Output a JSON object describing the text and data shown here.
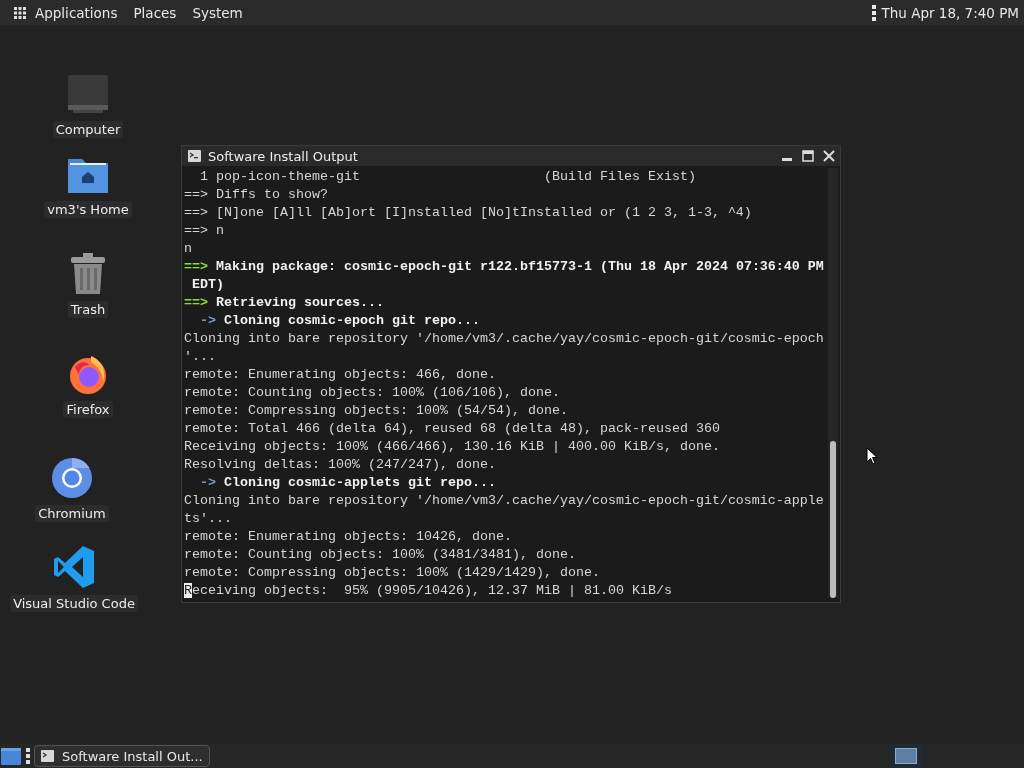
{
  "top_panel": {
    "menus": [
      {
        "label": "Applications"
      },
      {
        "label": "Places"
      },
      {
        "label": "System"
      }
    ],
    "clock": "Thu Apr 18,  7:40 PM"
  },
  "desktop_icons": [
    {
      "label": "Computer",
      "kind": "computer"
    },
    {
      "label": "vm3's Home",
      "kind": "home"
    },
    {
      "label": "Trash",
      "kind": "trash"
    },
    {
      "label": "Firefox",
      "kind": "firefox"
    },
    {
      "label": "Chromium",
      "kind": "chromium"
    },
    {
      "label": "Visual Studio Code",
      "kind": "vscode"
    }
  ],
  "window": {
    "title": "Software Install Output",
    "lines": [
      {
        "kind": "plain",
        "text": "  1 pop-icon-theme-git                       (Build Files Exist)",
        "cursor": false
      },
      {
        "kind": "plain",
        "text": "==> Diffs to show?",
        "cursor": false
      },
      {
        "kind": "plain",
        "text": "==> [N]one [A]ll [Ab]ort [I]nstalled [No]tInstalled or (1 2 3, 1-3, ^4)",
        "cursor": false
      },
      {
        "kind": "plain",
        "text": "==> n",
        "cursor": false
      },
      {
        "kind": "plain",
        "text": "n",
        "cursor": false
      },
      {
        "kind": "step",
        "prefix": "==>",
        "text": "Making package: cosmic-epoch-git r122.bf15773-1 (Thu 18 Apr 2024 07:36:40 PM",
        "cursor": false
      },
      {
        "kind": "bold",
        "text": " EDT)",
        "cursor": false
      },
      {
        "kind": "step",
        "prefix": "==>",
        "text": "Retrieving sources...",
        "cursor": false
      },
      {
        "kind": "substep",
        "prefix": "  ->",
        "text": "Cloning cosmic-epoch git repo...",
        "cursor": false
      },
      {
        "kind": "plain",
        "text": "Cloning into bare repository '/home/vm3/.cache/yay/cosmic-epoch-git/cosmic-epoch",
        "cursor": false
      },
      {
        "kind": "plain",
        "text": "'...",
        "cursor": false
      },
      {
        "kind": "plain",
        "text": "remote: Enumerating objects: 466, done.",
        "cursor": false
      },
      {
        "kind": "plain",
        "text": "remote: Counting objects: 100% (106/106), done.",
        "cursor": false
      },
      {
        "kind": "plain",
        "text": "remote: Compressing objects: 100% (54/54), done.",
        "cursor": false
      },
      {
        "kind": "plain",
        "text": "remote: Total 466 (delta 64), reused 68 (delta 48), pack-reused 360",
        "cursor": false
      },
      {
        "kind": "plain",
        "text": "Receiving objects: 100% (466/466), 130.16 KiB | 400.00 KiB/s, done.",
        "cursor": false
      },
      {
        "kind": "plain",
        "text": "Resolving deltas: 100% (247/247), done.",
        "cursor": false
      },
      {
        "kind": "substep",
        "prefix": "  ->",
        "text": "Cloning cosmic-applets git repo...",
        "cursor": false
      },
      {
        "kind": "plain",
        "text": "Cloning into bare repository '/home/vm3/.cache/yay/cosmic-epoch-git/cosmic-apple",
        "cursor": false
      },
      {
        "kind": "plain",
        "text": "ts'...",
        "cursor": false
      },
      {
        "kind": "plain",
        "text": "remote: Enumerating objects: 10426, done.",
        "cursor": false
      },
      {
        "kind": "plain",
        "text": "remote: Counting objects: 100% (3481/3481), done.",
        "cursor": false
      },
      {
        "kind": "plain",
        "text": "remote: Compressing objects: 100% (1429/1429), done.",
        "cursor": false
      },
      {
        "kind": "plain",
        "text": "Receiving objects:  95% (9905/10426), 12.37 MiB | 81.00 KiB/s",
        "cursor": true
      }
    ]
  },
  "taskbar": {
    "tasks": [
      {
        "label": "Software Install Out...",
        "selected": false
      }
    ],
    "workspaces": [
      {
        "selected": true
      }
    ]
  }
}
